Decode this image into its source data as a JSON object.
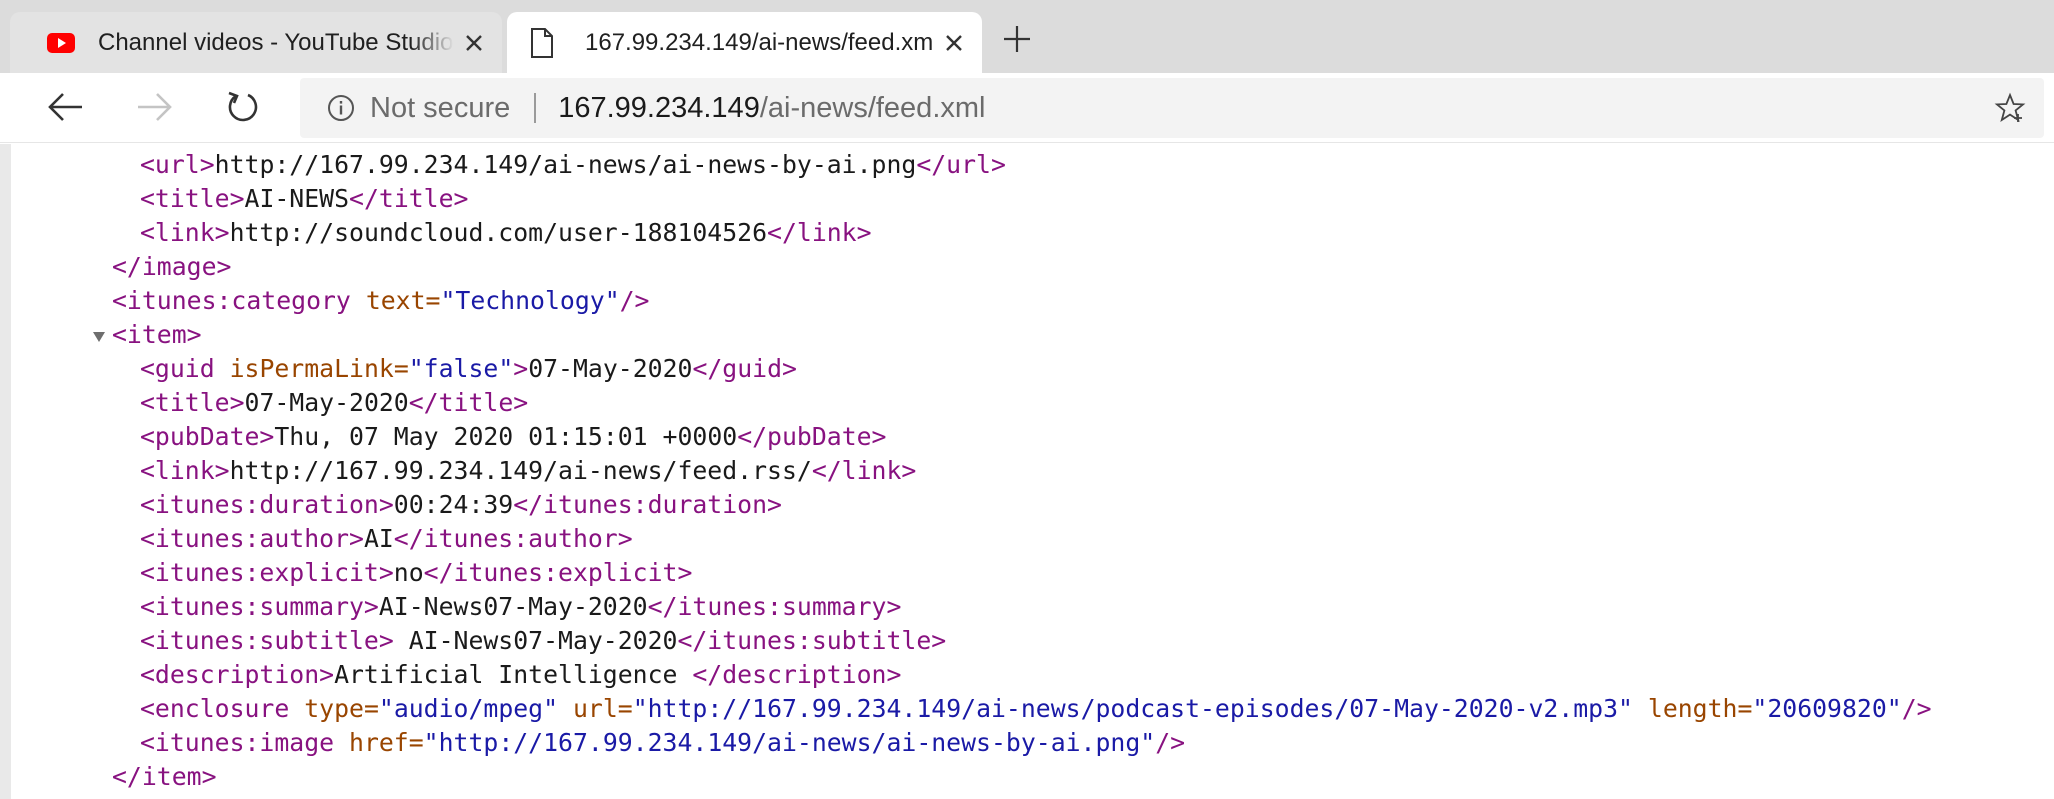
{
  "tabs": [
    {
      "title": "Channel videos - YouTube Studio",
      "icon": "youtube-icon",
      "active": false
    },
    {
      "title": "167.99.234.149/ai-news/feed.xml",
      "icon": "page-icon",
      "active": true
    }
  ],
  "toolbar": {
    "security_label": "Not secure",
    "url_host": "167.99.234.149",
    "url_path": "/ai-news/feed.xml"
  },
  "colors": {
    "tag": "#881280",
    "attribute_name": "#994500",
    "attribute_value": "#1a1aa6",
    "youtube_red": "#ff0000"
  },
  "xml": {
    "image_url_open": "<url>",
    "image_url_text": "http://167.99.234.149/ai-news/ai-news-by-ai.png",
    "image_url_close": "</url>",
    "image_title_open": "<title>",
    "image_title_text": "AI-NEWS",
    "image_title_close": "</title>",
    "image_link_open": "<link>",
    "image_link_text": "http://soundcloud.com/user-188104526",
    "image_link_close": "</link>",
    "image_close": "</image>",
    "category_open": "<itunes:category",
    "category_attr": "text=",
    "category_val": "\"Technology\"",
    "category_end": "/>",
    "item_open": "<item>",
    "guid_open": "<guid",
    "guid_attr": "isPermaLink=",
    "guid_val": "\"false\"",
    "guid_gt": ">",
    "guid_text": "07-May-2020",
    "guid_close": "</guid>",
    "title_open": "<title>",
    "title_text": "07-May-2020",
    "title_close": "</title>",
    "pubdate_open": "<pubDate>",
    "pubdate_text": "Thu, 07 May 2020 01:15:01 +0000",
    "pubdate_close": "</pubDate>",
    "link_open": "<link>",
    "link_text": "http://167.99.234.149/ai-news/feed.rss/",
    "link_close": "</link>",
    "duration_open": "<itunes:duration>",
    "duration_text": "00:24:39",
    "duration_close": "</itunes:duration>",
    "author_open": "<itunes:author>",
    "author_text": "AI",
    "author_close": "</itunes:author>",
    "explicit_open": "<itunes:explicit>",
    "explicit_text": "no",
    "explicit_close": "</itunes:explicit>",
    "summary_open": "<itunes:summary>",
    "summary_text": "AI-News07-May-2020",
    "summary_close": "</itunes:summary>",
    "subtitle_open": "<itunes:subtitle>",
    "subtitle_text": " AI-News07-May-2020",
    "subtitle_close": "</itunes:subtitle>",
    "description_open": "<description>",
    "description_text": "Artificial Intelligence ",
    "description_close": "</description>",
    "enclosure_open": "<enclosure",
    "enclosure_type_attr": "type=",
    "enclosure_type_val": "\"audio/mpeg\"",
    "enclosure_url_attr": "url=",
    "enclosure_url_val": "\"http://167.99.234.149/ai-news/podcast-episodes/07-May-2020-v2.mp3\"",
    "enclosure_length_attr": "length=",
    "enclosure_length_val": "\"20609820\"",
    "enclosure_end": "/>",
    "itimage_open": "<itunes:image",
    "itimage_attr": "href=",
    "itimage_val": "\"http://167.99.234.149/ai-news/ai-news-by-ai.png\"",
    "itimage_end": "/>",
    "item_close": "</item>"
  }
}
